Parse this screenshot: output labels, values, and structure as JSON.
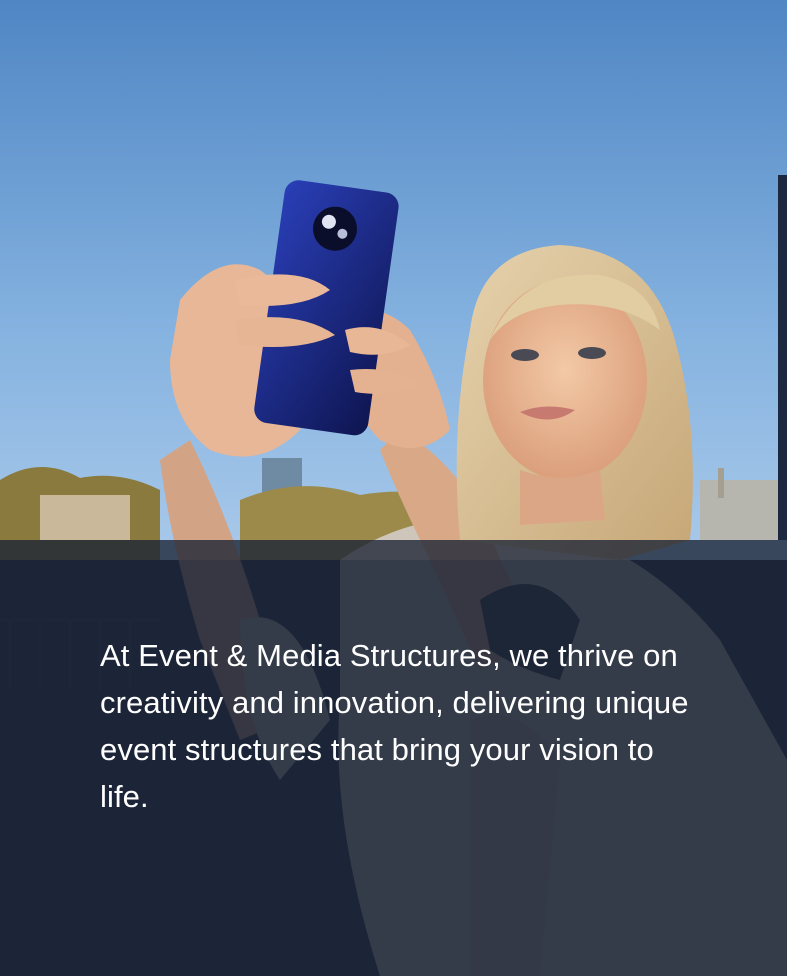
{
  "hero": {
    "photo_subject": "selfie-photo",
    "overlay_color": "#1a2234",
    "caption": "At Event & Media Structures, we thrive on creativity and innovation, delivering unique event structures that bring your vision to life."
  }
}
